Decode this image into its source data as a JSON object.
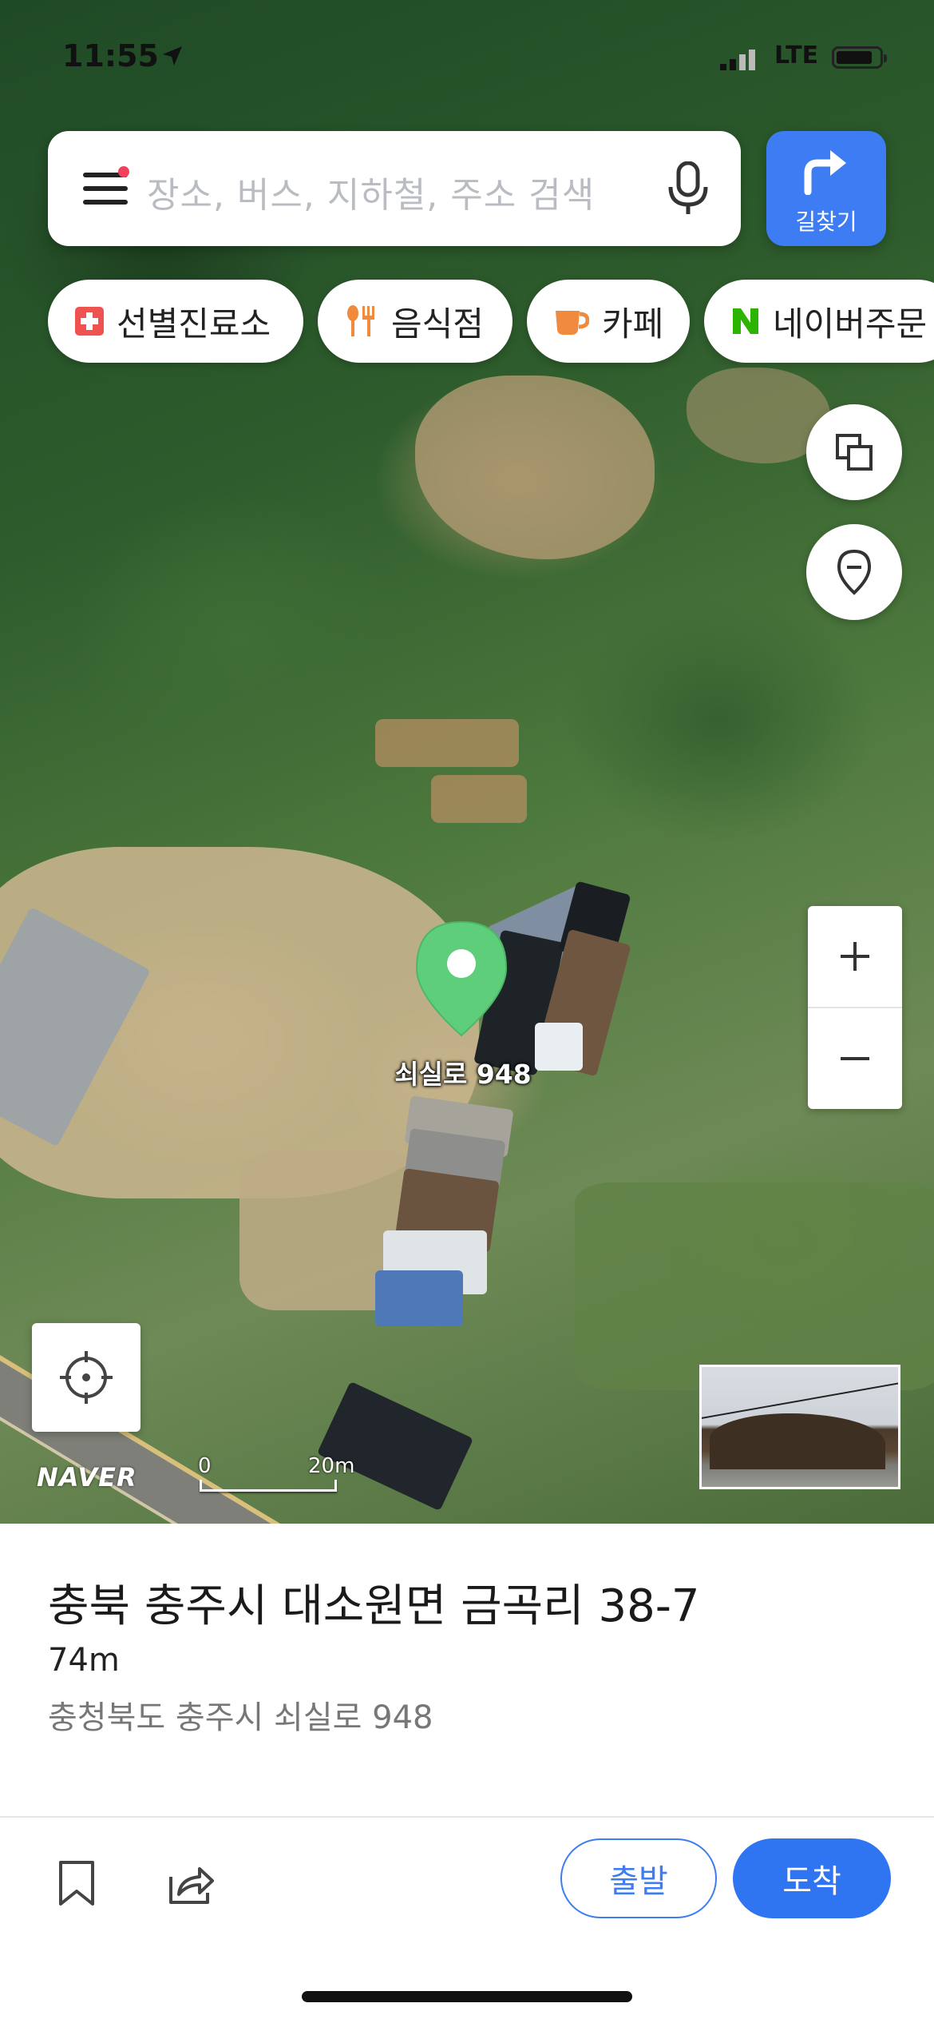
{
  "status_bar": {
    "time": "11:55",
    "network": "LTE"
  },
  "search": {
    "placeholder": "장소, 버스, 지하철, 주소 검색"
  },
  "route_button": {
    "label": "길찾기"
  },
  "chips": [
    {
      "label": "선별진료소",
      "icon": "hospital-cross-icon",
      "color": "#ef5350"
    },
    {
      "label": "음식점",
      "icon": "fork-knife-icon",
      "color": "#f08a3e"
    },
    {
      "label": "카페",
      "icon": "coffee-cup-icon",
      "color": "#f08a3e"
    },
    {
      "label": "네이버주문",
      "icon": "naver-n-icon",
      "color": "#2db400"
    }
  ],
  "map": {
    "pin_label": "쇠실로 948",
    "logo": "NAVER",
    "scale": {
      "start": "0",
      "end": "20m"
    },
    "pin_color": "#5fce7a"
  },
  "place": {
    "address": "충북 충주시 대소원면 금곡리 38-7",
    "distance": "74m",
    "road_address": "충청북도 충주시 쇠실로 948"
  },
  "actions": {
    "start": "출발",
    "arrive": "도착"
  },
  "colors": {
    "accent": "#3d7cf2"
  }
}
